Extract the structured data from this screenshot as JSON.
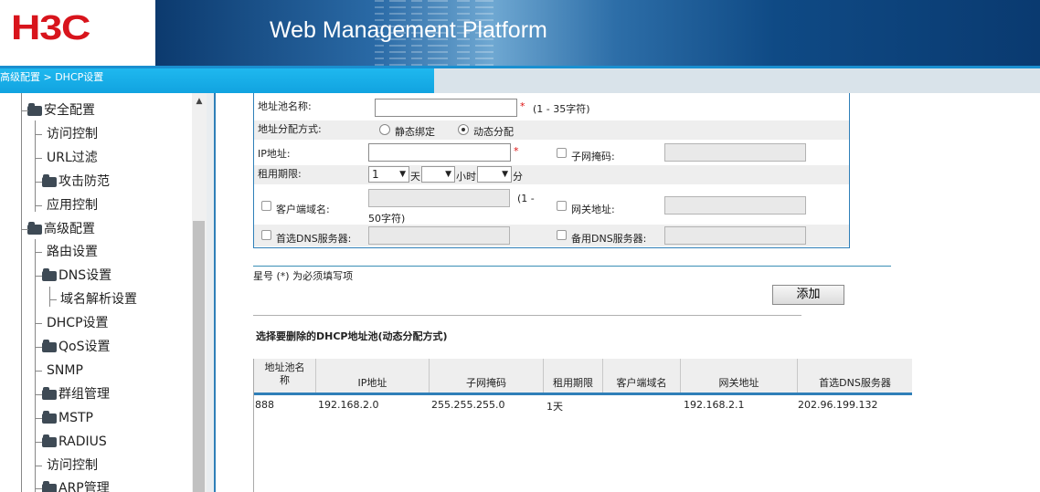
{
  "brand": {
    "logo": "H3C",
    "title": "Web Management Platform"
  },
  "breadcrumb": "高级配置 > DHCP设置",
  "sidebar": {
    "items": [
      {
        "label": "安全配置",
        "type": "folder"
      },
      {
        "label": "访问控制",
        "type": "leaf"
      },
      {
        "label": "URL过滤",
        "type": "leaf"
      },
      {
        "label": "攻击防范",
        "type": "folder-plus"
      },
      {
        "label": "应用控制",
        "type": "leaf"
      },
      {
        "label": "高级配置",
        "type": "folder"
      },
      {
        "label": "路由设置",
        "type": "leaf"
      },
      {
        "label": "DNS设置",
        "type": "folder"
      },
      {
        "label": "域名解析设置",
        "type": "leaf"
      },
      {
        "label": "DHCP设置",
        "type": "leaf"
      },
      {
        "label": "QoS设置",
        "type": "folder-plus"
      },
      {
        "label": "SNMP",
        "type": "leaf"
      },
      {
        "label": "群组管理",
        "type": "folder-plus"
      },
      {
        "label": "MSTP",
        "type": "folder-plus"
      },
      {
        "label": "RADIUS",
        "type": "folder-plus"
      },
      {
        "label": "访问控制",
        "type": "leaf"
      },
      {
        "label": "ARP管理",
        "type": "folder-plus"
      }
    ]
  },
  "form": {
    "pool_name_label": "地址池名称:",
    "pool_name_value": "",
    "pool_name_hint": "(1 - 35字符)",
    "required_mark": "*",
    "alloc_label": "地址分配方式:",
    "alloc_static": "静态绑定",
    "alloc_dynamic": "动态分配",
    "alloc_selected": "动态分配",
    "ip_label": "IP地址:",
    "ip_value": "",
    "subnet_label": "子网掩码:",
    "lease_label": "租用期限:",
    "lease_days": "1",
    "lease_days_unit": "天",
    "lease_hours": "",
    "lease_hours_unit": "小时",
    "lease_minutes": "",
    "lease_minutes_unit": "分",
    "client_domain_label": "客户端域名:",
    "client_domain_hint_a": "(1 -",
    "client_domain_hint_b": "50字符)",
    "gateway_label": "网关地址:",
    "primary_dns_label": "首选DNS服务器:",
    "backup_dns_label": "备用DNS服务器:"
  },
  "note": "星号 (*) 为必须填写项",
  "add_button": "添加",
  "delete_section_title": "选择要删除的DHCP地址池(动态分配方式)",
  "table": {
    "headers": [
      "地址池名称",
      "IP地址",
      "子网掩码",
      "租用期限",
      "客户端域名",
      "网关地址",
      "首选DNS服务器"
    ],
    "header_line1": "地址池名",
    "header_line2": "称",
    "rows": [
      [
        "888",
        "192.168.2.0",
        "255.255.255.0",
        "1天",
        "",
        "192.168.2.1",
        "202.96.199.132"
      ]
    ]
  },
  "colors": {
    "accent": "#1fb8ef",
    "brand_red": "#d8141c",
    "border_blue": "#2f7fb8"
  }
}
